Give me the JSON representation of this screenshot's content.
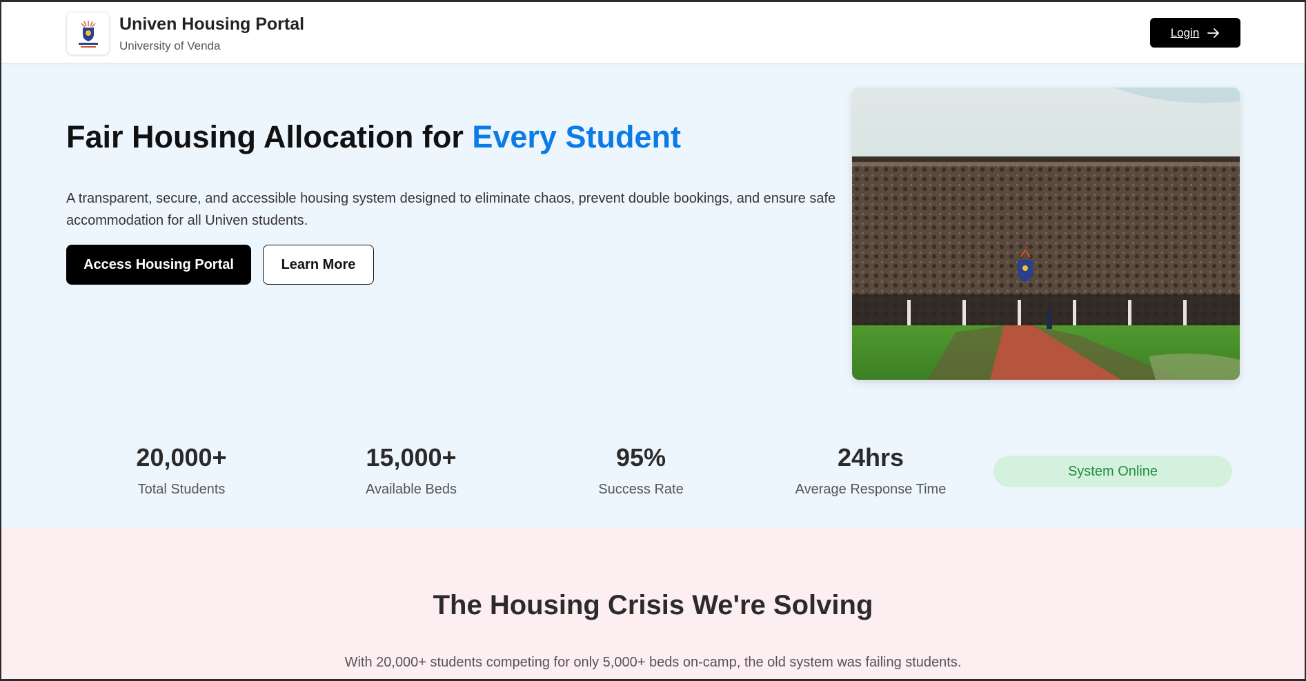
{
  "header": {
    "title": "Univen Housing Portal",
    "subtitle": "University of Venda",
    "login_label": "Login",
    "login_icon": "arrow-right-icon"
  },
  "hero": {
    "title_main": "Fair Housing Allocation for ",
    "title_accent": "Every Student",
    "description": "A transparent, secure, and accessible housing system designed to eliminate chaos, prevent double bookings, and ensure safe accommodation for all Univen students.",
    "primary_button": "Access Housing Portal",
    "secondary_button": "Learn More",
    "accent_color": "#0b7be6"
  },
  "stats": [
    {
      "value": "20,000+",
      "label": "Total Students"
    },
    {
      "value": "15,000+",
      "label": "Available Beds"
    },
    {
      "value": "95%",
      "label": "Success Rate"
    },
    {
      "value": "24hrs",
      "label": "Average Response Time"
    }
  ],
  "status": {
    "label": "System Online",
    "color": "#1e8c3f"
  },
  "crisis": {
    "title": "The Housing Crisis We're Solving",
    "description": "With 20,000+ students competing for only 5,000+ beds on-camp, the old system was failing students."
  }
}
